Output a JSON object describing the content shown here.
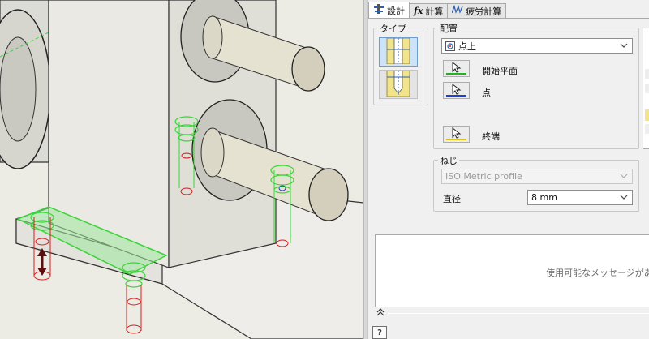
{
  "tabs": [
    {
      "label": "設計",
      "icon": "design-tab-icon"
    },
    {
      "label": "計算",
      "icon": "calc-fx-icon"
    },
    {
      "label": "疲労計算",
      "icon": "fatigue-graph-icon"
    }
  ],
  "type_group": {
    "label": "タイプ",
    "options": [
      "through-hole-type-icon",
      "blind-hole-type-icon"
    ],
    "selected": 0
  },
  "placement": {
    "label": "配置",
    "value": "点上",
    "start_plane_label": "開始平面",
    "point_label": "点",
    "end_label": "終端"
  },
  "thread": {
    "label": "ねじ",
    "profile": "ISO Metric profile",
    "diameter_label": "直径",
    "diameter_value": "8 mm"
  },
  "messages": {
    "text": "使用可能なメッセージがありま"
  },
  "colors": {
    "selected_fill": "#cde3f7",
    "start_plane_bar": "#26b026",
    "point_bar": "#1f3fd0",
    "end_bar": "#d8c41a",
    "model_highlight": "#3ad43a",
    "hole_red": "#d42020"
  }
}
